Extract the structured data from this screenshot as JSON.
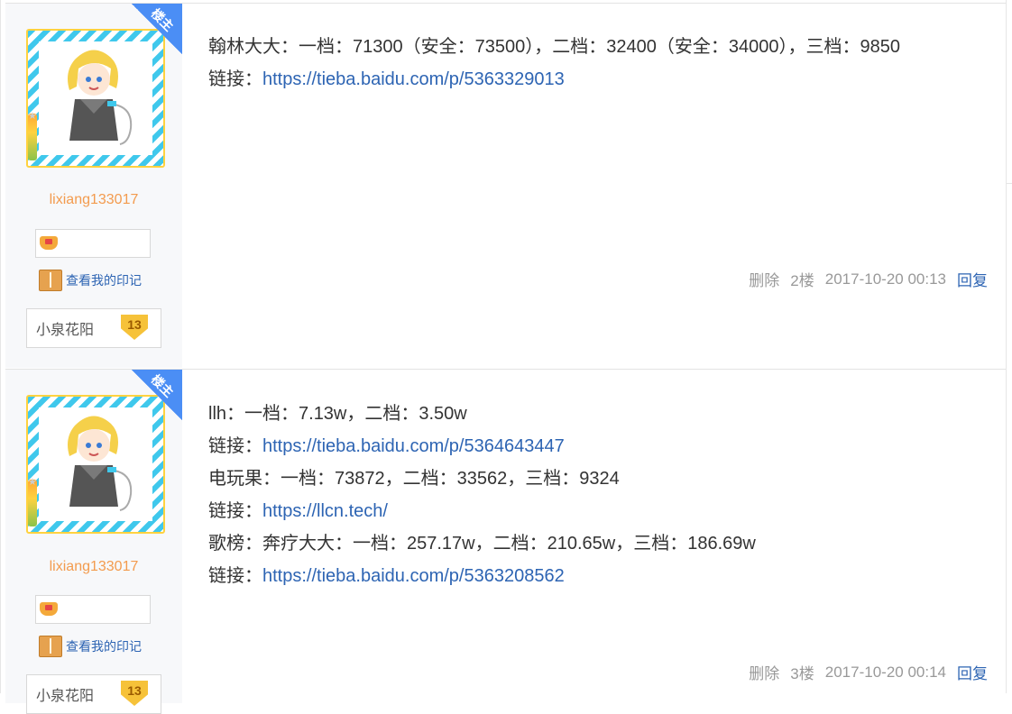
{
  "posts": [
    {
      "author": {
        "username": "lixiang133017",
        "op_badge": "楼主",
        "mark_link": "查看我的印记",
        "badge_name": "小泉花阳",
        "badge_level": "13"
      },
      "lines": [
        {
          "label": "翰林大大：一档：71300（安全：73500），二档：32400（安全：34000），三档：9850",
          "link": ""
        },
        {
          "label": "链接：",
          "link": "https://tieba.baidu.com/p/5363329013"
        }
      ],
      "meta": {
        "delete": "删除",
        "floor": "2楼",
        "time": "2017-10-20 00:13",
        "reply": "回复"
      }
    },
    {
      "author": {
        "username": "lixiang133017",
        "op_badge": "楼主",
        "mark_link": "查看我的印记",
        "badge_name": "小泉花阳",
        "badge_level": "13"
      },
      "lines": [
        {
          "label": "llh：一档：7.13w，二档：3.50w",
          "link": ""
        },
        {
          "label": "链接：",
          "link": "https://tieba.baidu.com/p/5364643447"
        },
        {
          "label": "电玩果：一档：73872，二档：33562，三档：9324",
          "link": ""
        },
        {
          "label": "链接：",
          "link": "https://llcn.tech/"
        },
        {
          "label": "歌榜：奔疗大大：一档：257.17w，二档：210.65w，三档：186.69w",
          "link": ""
        },
        {
          "label": "链接：",
          "link": "https://tieba.baidu.com/p/5363208562"
        }
      ],
      "meta": {
        "delete": "删除",
        "floor": "3楼",
        "time": "2017-10-20 00:14",
        "reply": "回复"
      }
    }
  ],
  "icons": {
    "avatar": "anime-character-avatar",
    "honor": "honor-badge-icon",
    "mark": "book-icon",
    "level": "level-gem-icon"
  },
  "colors": {
    "link": "#2d64b3",
    "username": "#f39b4e",
    "op_badge": "#4b8ef5",
    "avatar_stripe": "#3fc8ec",
    "avatar_border": "#ffd23f",
    "meta_text": "#999999"
  }
}
